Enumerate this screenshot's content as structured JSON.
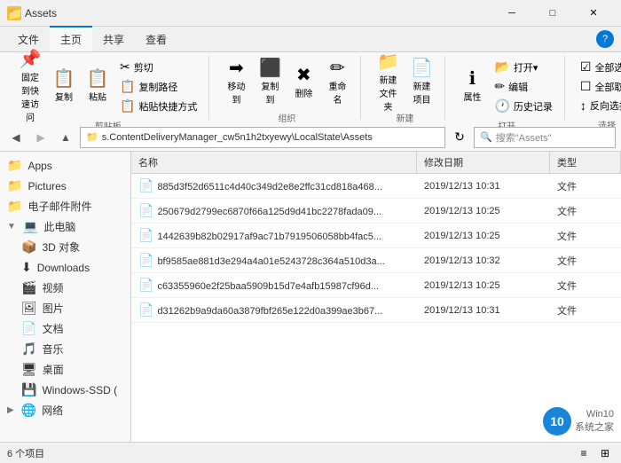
{
  "titlebar": {
    "title": "Assets",
    "icon": "📁",
    "minimize_label": "─",
    "maximize_label": "□",
    "close_label": "✕"
  },
  "ribbon": {
    "tabs": [
      "文件",
      "主页",
      "共享",
      "查看"
    ],
    "active_tab": "主页",
    "groups": {
      "clipboard": {
        "label": "剪贴板",
        "pin_label": "固定到快\n速访问",
        "copy_label": "复制",
        "paste_label": "粘贴",
        "cut_label": "剪切",
        "copy_path_label": "复制路径",
        "paste_shortcut_label": "粘贴快捷方式"
      },
      "organize": {
        "label": "组织",
        "move_label": "移动到",
        "copy_label": "复制到",
        "delete_label": "删除",
        "rename_label": "重命名"
      },
      "new": {
        "label": "新建",
        "new_folder_label": "新建\n文件夹",
        "new_item_label": "新建\n项目"
      },
      "open": {
        "label": "打开",
        "open_label": "打开▾",
        "edit_label": "编辑",
        "history_label": "历史记录",
        "properties_label": "属性"
      },
      "select": {
        "label": "选择",
        "select_all_label": "全部选择",
        "select_none_label": "全部取消",
        "invert_label": "反向选择"
      }
    }
  },
  "addressbar": {
    "back_disabled": false,
    "forward_disabled": true,
    "up_disabled": false,
    "path": "s.ContentDeliveryManager_cw5n1h2txyewy\\LocalState\\Assets",
    "search_placeholder": "搜索\"Assets\""
  },
  "sidebar": {
    "quick_access_items": [
      {
        "label": "Apps",
        "icon": "📁",
        "has_arrow": false
      },
      {
        "label": "Pictures",
        "icon": "📁",
        "has_arrow": false
      },
      {
        "label": "电子邮件附件",
        "icon": "📁",
        "has_arrow": false
      }
    ],
    "this_pc_label": "此电脑",
    "this_pc_items": [
      {
        "label": "3D 对象",
        "icon": "📦"
      },
      {
        "label": "Downloads",
        "icon": "⬇"
      },
      {
        "label": "视频",
        "icon": "🎬"
      },
      {
        "label": "图片",
        "icon": "🖼"
      },
      {
        "label": "文档",
        "icon": "📄"
      },
      {
        "label": "音乐",
        "icon": "🎵"
      },
      {
        "label": "桌面",
        "icon": "🖥"
      }
    ],
    "drives": [
      {
        "label": "Windows-SSD (",
        "icon": "💾"
      }
    ],
    "network_label": "网络",
    "network_icon": "🌐"
  },
  "filelist": {
    "columns": {
      "name": "名称",
      "date": "修改日期",
      "type": "类型"
    },
    "files": [
      {
        "name": "885d3f52d6511c4d40c349d2e8e2ffc31cd818a468...",
        "date": "2019/12/13 10:31",
        "type": "文件"
      },
      {
        "name": "250679d2799ec6870f66a125d9d41bc2278fada09...",
        "date": "2019/12/13 10:25",
        "type": "文件"
      },
      {
        "name": "1442639b82b02917af9ac71b7919506058bb4fac5...",
        "date": "2019/12/13 10:25",
        "type": "文件"
      },
      {
        "name": "bf9585ae881d3e294a4a01e5243728c364a510d3a...",
        "date": "2019/12/13 10:32",
        "type": "文件"
      },
      {
        "name": "c63355960e2f25baa5909b15d7e4afb15987cf96d...",
        "date": "2019/12/13 10:25",
        "type": "文件"
      },
      {
        "name": "d31262b9a9da60a3879fbf265e122d0a399ae3b67...",
        "date": "2019/12/13 10:31",
        "type": "文件"
      }
    ]
  },
  "statusbar": {
    "count_label": "6 个项目"
  },
  "watermark": {
    "logo": "10",
    "line1": "Win10",
    "line2": "系统之家"
  }
}
